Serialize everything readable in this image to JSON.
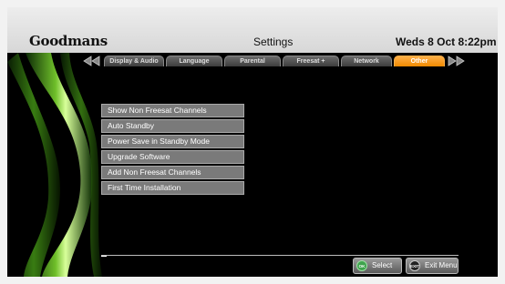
{
  "header": {
    "brand": "Goodmans",
    "title": "Settings",
    "datetime": "Weds 8 Oct  8:22pm"
  },
  "tabs": [
    {
      "label": "Display & Audio",
      "active": false
    },
    {
      "label": "Language",
      "active": false
    },
    {
      "label": "Parental",
      "active": false
    },
    {
      "label": "Freesat +",
      "active": false
    },
    {
      "label": "Network",
      "active": false
    },
    {
      "label": "Other",
      "active": true
    }
  ],
  "menu": {
    "items": [
      "Show Non Freesat Channels",
      "Auto Standby",
      "Power Save in Standby Mode",
      "Upgrade Software",
      "Add Non Freesat Channels",
      "First Time Installation"
    ]
  },
  "footer": {
    "select_icon": "OK",
    "select_label": "Select",
    "exit_icon": "EXIT",
    "exit_label": "Exit Menu"
  },
  "colors": {
    "accent_tab": "#f18a00",
    "ok_button": "#3fa34d",
    "exit_button": "#222222"
  },
  "icons": [
    "left-double-arrow-icon",
    "right-double-arrow-icon",
    "ok-button-icon",
    "exit-button-icon",
    "green-swoosh-decoration"
  ]
}
